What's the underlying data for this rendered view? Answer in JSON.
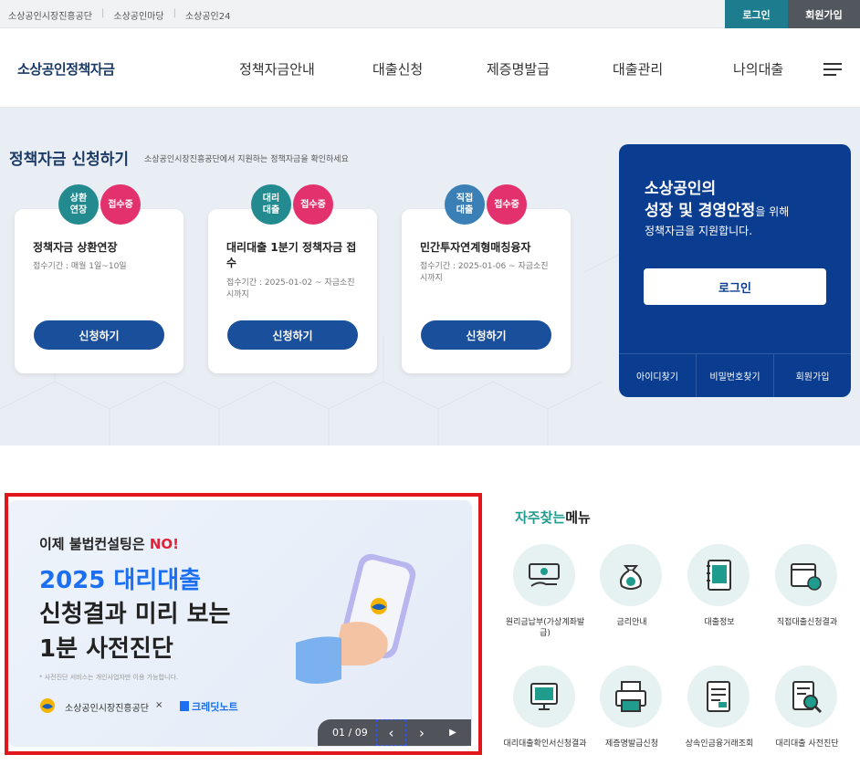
{
  "topbar": {
    "links": [
      "소상공인시장진흥공단",
      "소상공인마당",
      "소상공인24"
    ],
    "login": "로그인",
    "join": "회원가입"
  },
  "header": {
    "logo": "소상공인정책자금",
    "nav": [
      "정책자금안내",
      "대출신청",
      "제증명발급",
      "대출관리",
      "나의대출"
    ]
  },
  "hero": {
    "title": "정책자금 신청하기",
    "subtitle": "소상공인시장진흥공단에서 지원하는 정책자금을 확인하세요",
    "cards": [
      {
        "badge_type": "상환\n연장",
        "badge_status": "접수중",
        "title": "정책자금 상환연장",
        "period": "접수기간 : 매월 1일~10일",
        "button": "신청하기"
      },
      {
        "badge_type": "대리\n대출",
        "badge_status": "접수중",
        "title": "대리대출 1분기 정책자금 접수",
        "period": "접수기간 : 2025-01-02 ~ 자금소진 시까지",
        "button": "신청하기"
      },
      {
        "badge_type": "직접\n대출",
        "badge_status": "접수중",
        "title": "민간투자연계형매칭융자",
        "period": "접수기간 : 2025-01-06 ~ 자금소진 시까지",
        "button": "신청하기"
      }
    ]
  },
  "login_panel": {
    "line1": "소상공인의",
    "line2_bold": "성장 및 경영안정",
    "line2_rest": "을 위해",
    "line3": "정책자금을 지원합니다.",
    "login_button": "로그인",
    "links": [
      "아이디찾기",
      "비밀번호찾기",
      "회원가입"
    ]
  },
  "banner": {
    "line1_prefix": "이제 불법컨설팅은 ",
    "line1_highlight": "NO!",
    "line2": "2025 대리대출",
    "line3": "신청결과 미리 보는",
    "line4": "1분 사전진단",
    "note": "* 사전진단 서비스는 개인사업자만 이용 가능합니다.",
    "org": "소상공인시장진흥공단",
    "x": "×",
    "partner": "크레딧노트",
    "pager": {
      "count": "01 / 09",
      "prev": "‹",
      "next": "›",
      "play": "▶"
    }
  },
  "favorites": {
    "title_highlight": "자주찾는",
    "title_rest": "메뉴",
    "items": [
      {
        "label": "원리금납부(가상계좌발급)",
        "icon": "money-hand-icon"
      },
      {
        "label": "금리안내",
        "icon": "money-bag-icon"
      },
      {
        "label": "대출정보",
        "icon": "notebook-icon"
      },
      {
        "label": "직접대출신청결과",
        "icon": "calendar-clock-icon"
      },
      {
        "label": "대리대출확인서신청결과",
        "icon": "monitor-icon"
      },
      {
        "label": "제증명발급신청",
        "icon": "printer-icon"
      },
      {
        "label": "상속인금융거래조회",
        "icon": "document-icon"
      },
      {
        "label": "대리대출 사전진단",
        "icon": "doc-search-icon"
      }
    ]
  },
  "colors": {
    "primary": "#1a4f9c",
    "panel": "#0a3d8f",
    "teal": "#238a8f",
    "pink": "#e3316e",
    "highlight_frame": "#e0161c"
  }
}
